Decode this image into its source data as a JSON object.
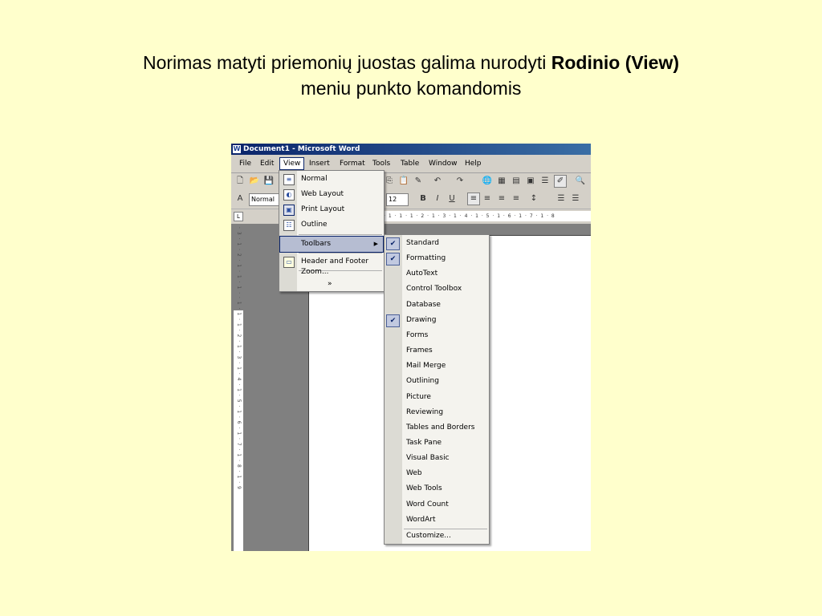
{
  "slide": {
    "title_normal": "Norimas matyti priemonių juostas galima nurodyti ",
    "title_bold": "Rodinio (View)",
    "title_line2": "meniu punkto komandomis"
  },
  "window": {
    "title": "Document1 - Microsoft Word",
    "app_icon": "W"
  },
  "menubar": [
    "File",
    "Edit",
    "View",
    "Insert",
    "Format",
    "Tools",
    "Table",
    "Window",
    "Help"
  ],
  "formatting": {
    "style": "Normal",
    "size": "12",
    "bold": "B",
    "italic": "I",
    "underline": "U"
  },
  "ruler": {
    "corner": "L",
    "horizontal": "· 1 · 1 · 1 · 2 · 1 · 3 · 1 · 4 · 1 · 5 · 1 · 6 · 1 · 7 · 1 · 8",
    "vertical": "· 3 · 1 · 2 · 1 · 1 · 1 · · 1 · 1 · 1 · 2 · 1 · 3 · 1 · 4 · 1 · 5 · 1 · 6 · 1 · 7 · 1 · 8 · 1 · 9"
  },
  "view_menu": {
    "items": [
      "Normal",
      "Web Layout",
      "Print Layout",
      "Outline",
      "Toolbars",
      "Header and Footer",
      "Zoom..."
    ],
    "expand": "»"
  },
  "toolbars_menu": {
    "items": [
      "Standard",
      "Formatting",
      "AutoText",
      "Control Toolbox",
      "Database",
      "Drawing",
      "Forms",
      "Frames",
      "Mail Merge",
      "Outlining",
      "Picture",
      "Reviewing",
      "Tables and Borders",
      "Task Pane",
      "Visual Basic",
      "Web",
      "Web Tools",
      "Word Count",
      "WordArt"
    ],
    "checked": [
      "Standard",
      "Formatting",
      "Drawing"
    ],
    "customize": "Customize...",
    "check_glyph": "✔"
  }
}
